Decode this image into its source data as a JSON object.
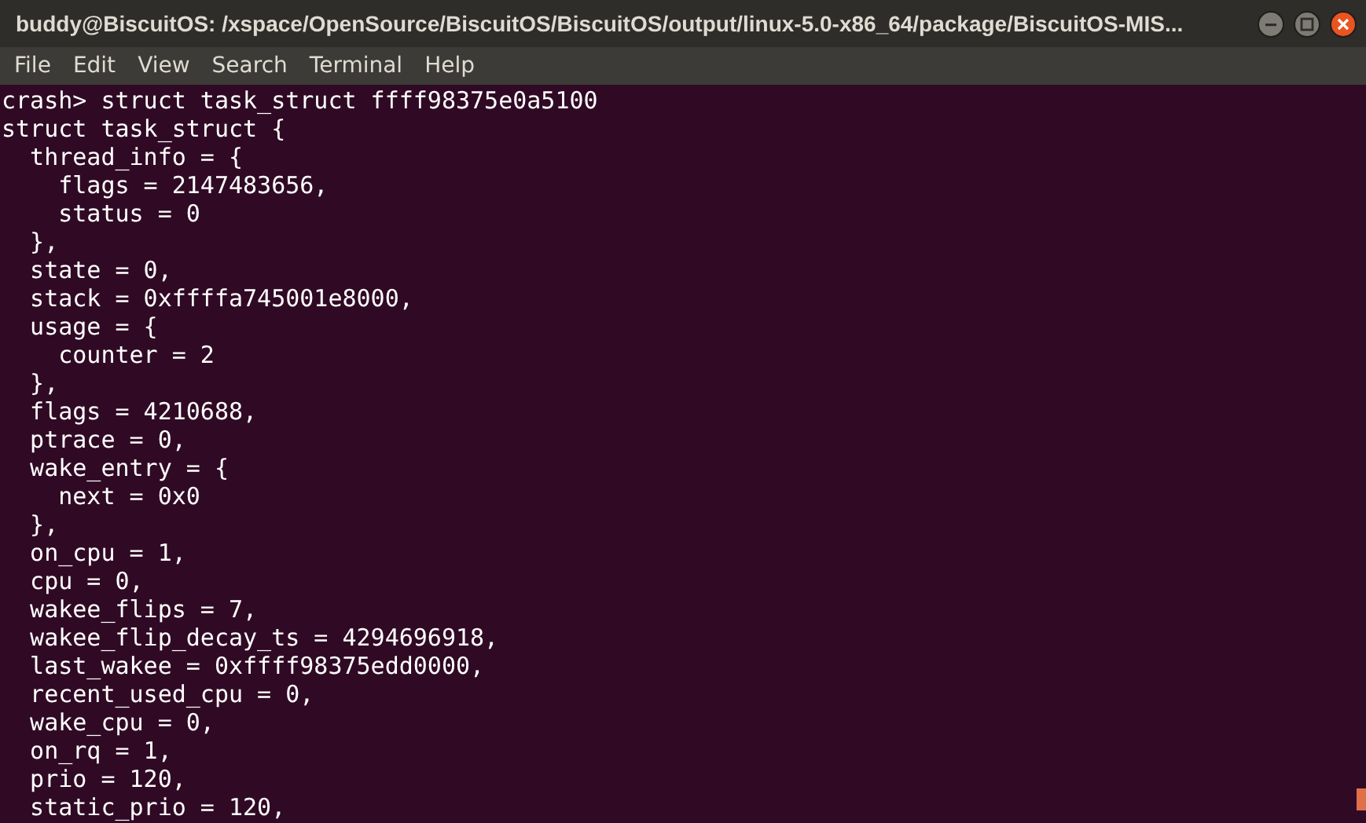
{
  "window": {
    "title": "buddy@BiscuitOS: /xspace/OpenSource/BiscuitOS/BiscuitOS/output/linux-5.0-x86_64/package/BiscuitOS-MIS..."
  },
  "menu": [
    "File",
    "Edit",
    "View",
    "Search",
    "Terminal",
    "Help"
  ],
  "terminal": {
    "lines": [
      "crash> struct task_struct ffff98375e0a5100",
      "struct task_struct {",
      "  thread_info = {",
      "    flags = 2147483656,",
      "    status = 0",
      "  },",
      "  state = 0,",
      "  stack = 0xffffa745001e8000,",
      "  usage = {",
      "    counter = 2",
      "  },",
      "  flags = 4210688,",
      "  ptrace = 0,",
      "  wake_entry = {",
      "    next = 0x0",
      "  },",
      "  on_cpu = 1,",
      "  cpu = 0,",
      "  wakee_flips = 7,",
      "  wakee_flip_decay_ts = 4294696918,",
      "  last_wakee = 0xffff98375edd0000,",
      "  recent_used_cpu = 0,",
      "  wake_cpu = 0,",
      "  on_rq = 1,",
      "  prio = 120,",
      "  static_prio = 120,"
    ]
  }
}
